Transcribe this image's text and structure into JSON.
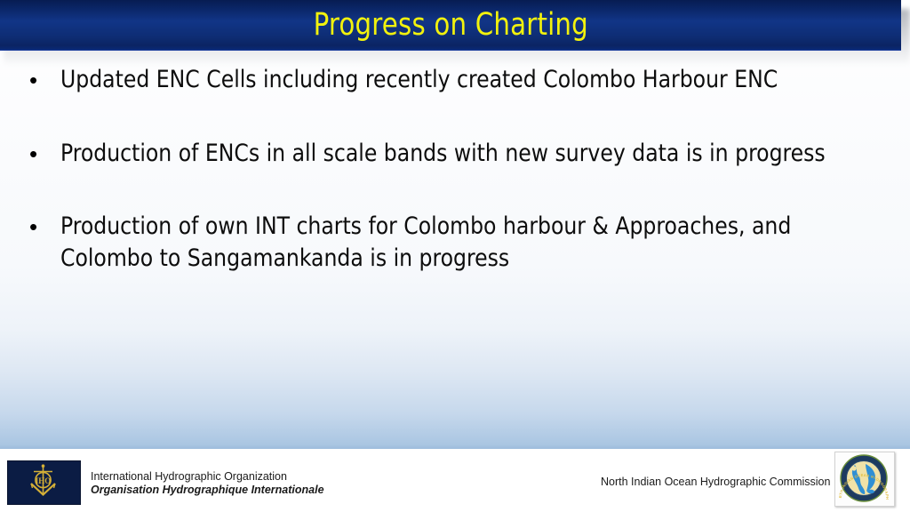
{
  "slide": {
    "title": "Progress on Charting",
    "title_color": "#f2f20d",
    "title_bar_color": "#113587",
    "background_top_color": "#ffffff",
    "background_bottom_color": "#9dbcdc"
  },
  "body": {
    "bullet_glyph": "•",
    "bullets": [
      {
        "text": "Updated ENC Cells including recently created Colombo Harbour ENC",
        "align": "left"
      },
      {
        "text": "Production of ENCs in all scale bands with new survey data is in progress",
        "align": "justify"
      },
      {
        "text": "Production of own INT charts for Colombo harbour & Approaches, and Colombo to Sangamankanda is in progress",
        "align": "left"
      }
    ]
  },
  "footer": {
    "iho": {
      "logo_name": "iho-anchor-emblem",
      "logo_background": "#0b1c44",
      "logo_emblem_color": "#d4af37",
      "line1": "International Hydrographic Organization",
      "line2": "Organisation Hydrographique Internationale"
    },
    "niohc": {
      "label": "North Indian Ocean Hydrographic Commission",
      "seal_name": "niohc-circular-seal",
      "seal_ring_color": "#1d3a5f",
      "seal_text_color": "#e2c044",
      "seal_inner_color": "#f0e2a8",
      "seal_land_color": "#2f8fd4",
      "seal_ring_text": "NORTH INDIAN OCEAN HYDROGRAPHIC COMMISSION"
    }
  }
}
